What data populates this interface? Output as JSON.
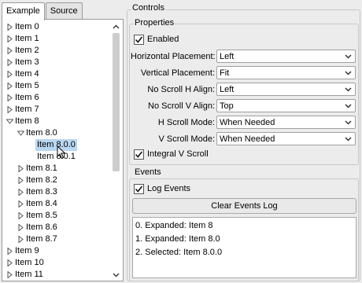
{
  "tabs": [
    {
      "label": "Example",
      "active": true
    },
    {
      "label": "Source",
      "active": false
    }
  ],
  "tree": {
    "rows": [
      {
        "label": "Item 0",
        "level": 0,
        "expander": "collapsed"
      },
      {
        "label": "Item 1",
        "level": 0,
        "expander": "collapsed"
      },
      {
        "label": "Item 2",
        "level": 0,
        "expander": "collapsed"
      },
      {
        "label": "Item 3",
        "level": 0,
        "expander": "collapsed"
      },
      {
        "label": "Item 4",
        "level": 0,
        "expander": "collapsed"
      },
      {
        "label": "Item 5",
        "level": 0,
        "expander": "collapsed"
      },
      {
        "label": "Item 6",
        "level": 0,
        "expander": "collapsed"
      },
      {
        "label": "Item 7",
        "level": 0,
        "expander": "collapsed"
      },
      {
        "label": "Item 8",
        "level": 0,
        "expander": "expanded"
      },
      {
        "label": "Item 8.0",
        "level": 1,
        "expander": "expanded"
      },
      {
        "label": "Item 8.0.0",
        "level": 2,
        "expander": "none",
        "selected": true
      },
      {
        "label": "Item 8.0.1",
        "level": 2,
        "expander": "none"
      },
      {
        "label": "Item 8.1",
        "level": 1,
        "expander": "collapsed"
      },
      {
        "label": "Item 8.2",
        "level": 1,
        "expander": "collapsed"
      },
      {
        "label": "Item 8.3",
        "level": 1,
        "expander": "collapsed"
      },
      {
        "label": "Item 8.4",
        "level": 1,
        "expander": "collapsed"
      },
      {
        "label": "Item 8.5",
        "level": 1,
        "expander": "collapsed"
      },
      {
        "label": "Item 8.6",
        "level": 1,
        "expander": "collapsed"
      },
      {
        "label": "Item 8.7",
        "level": 1,
        "expander": "collapsed"
      },
      {
        "label": "Item 9",
        "level": 0,
        "expander": "collapsed"
      },
      {
        "label": "Item 10",
        "level": 0,
        "expander": "collapsed"
      },
      {
        "label": "Item 11",
        "level": 0,
        "expander": "collapsed"
      }
    ]
  },
  "controls": {
    "title": "Controls",
    "properties": {
      "title": "Properties",
      "enabled": {
        "label": "Enabled",
        "checked": true
      },
      "fields": [
        {
          "label": "Horizontal Placement:",
          "value": "Left"
        },
        {
          "label": "Vertical Placement:",
          "value": "Fit"
        },
        {
          "label": "No Scroll H Align:",
          "value": "Left"
        },
        {
          "label": "No Scroll V Align:",
          "value": "Top"
        },
        {
          "label": "H Scroll Mode:",
          "value": "When Needed"
        },
        {
          "label": "V Scroll Mode:",
          "value": "When Needed"
        }
      ],
      "integral_v_scroll": {
        "label": "Integral V Scroll",
        "checked": true
      }
    },
    "events": {
      "title": "Events",
      "log_events": {
        "label": "Log Events",
        "checked": true
      },
      "clear_button": "Clear Events Log",
      "log": [
        "0. Expanded: Item 8",
        "1. Expanded: Item 8.0",
        "2. Selected: Item 8.0.0"
      ]
    }
  },
  "colors": {
    "selection": "#b9d7f2",
    "background": "#ececec"
  },
  "icons": {
    "collapsed": "triangle-right-icon",
    "expanded": "triangle-down-icon",
    "dropdown": "chevron-down-icon",
    "check": "check-icon"
  }
}
